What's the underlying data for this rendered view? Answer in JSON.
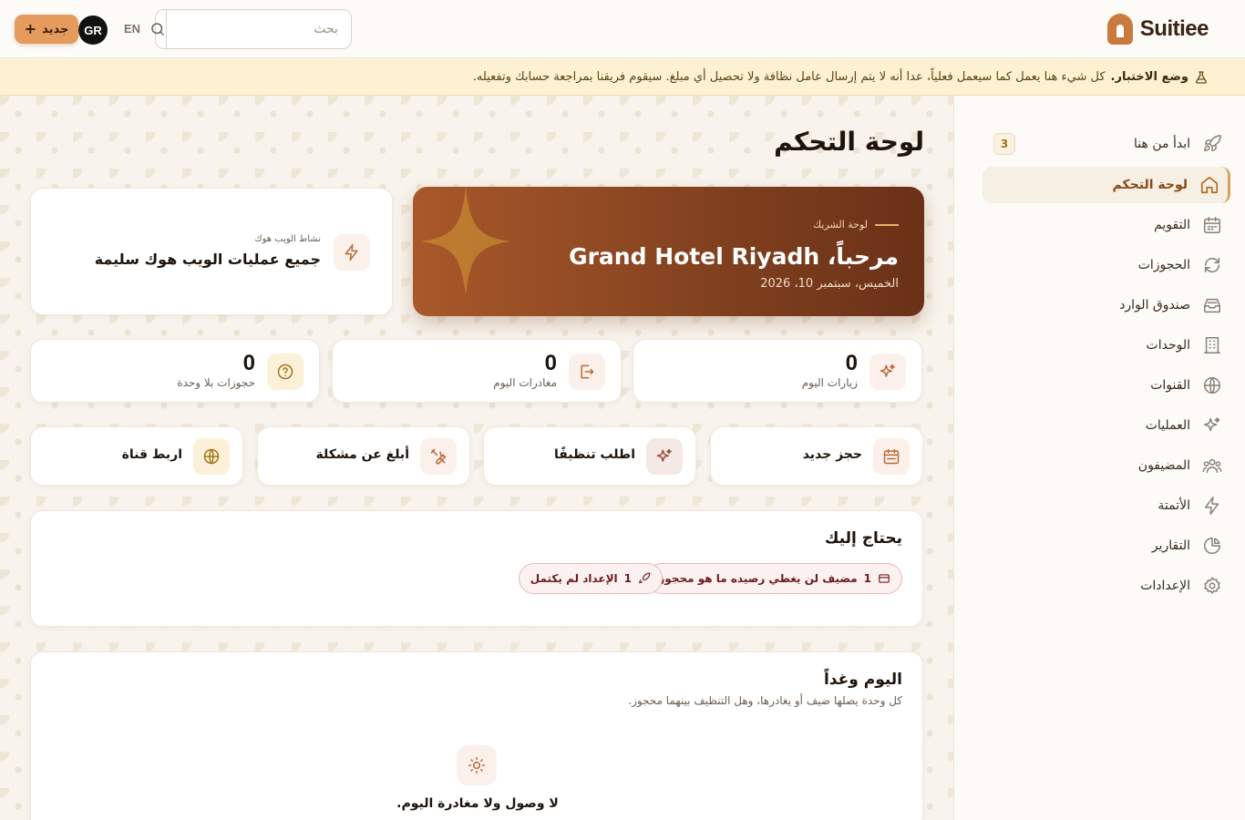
{
  "app": {
    "brand": "Suitiee"
  },
  "header": {
    "search_placeholder": "بحث",
    "lang": "EN",
    "avatar_initials": "GR",
    "new_label": "جديد"
  },
  "banner": {
    "title": "وضع الاختبار.",
    "text": "كل شيء هنا يعمل كما سيعمل فعلياً، عدا أنه لا يتم إرسال عامل نظافة ولا تحصيل أي مبلغ. سيقوم فريقنا بمراجعة حسابك وتفعيله."
  },
  "sidebar": {
    "items": [
      {
        "label": "ابدأ من هنا",
        "icon": "rocket-icon",
        "badge": "3"
      },
      {
        "label": "لوحة التحكم",
        "icon": "home-icon",
        "active": true
      },
      {
        "label": "التقويم",
        "icon": "calendar-icon"
      },
      {
        "label": "الحجوزات",
        "icon": "refresh-icon"
      },
      {
        "label": "صندوق الوارد",
        "icon": "inbox-icon"
      },
      {
        "label": "الوحدات",
        "icon": "building-icon"
      },
      {
        "label": "القنوات",
        "icon": "globe-icon"
      },
      {
        "label": "العمليات",
        "icon": "sparkles-icon"
      },
      {
        "label": "المضيفون",
        "icon": "users-icon"
      },
      {
        "label": "الأتمتة",
        "icon": "bolt-icon"
      },
      {
        "label": "التقارير",
        "icon": "pie-chart-icon"
      },
      {
        "label": "الإعدادات",
        "icon": "gear-icon"
      }
    ]
  },
  "main": {
    "title": "لوحة التحكم",
    "hero": {
      "kicker": "لوحة الشريك",
      "greeting": "مرحباً، Grand Hotel Riyadh",
      "date": "الخميس، سبتمبر 10، 2026"
    },
    "webhook": {
      "label": "نشاط الويب هوك",
      "status": "جميع عمليات الويب هوك سليمة"
    },
    "stats": [
      {
        "value": "0",
        "label": "زيارات اليوم",
        "icon": "sparkles-icon"
      },
      {
        "value": "0",
        "label": "مغادرات اليوم",
        "icon": "logout-icon"
      },
      {
        "value": "0",
        "label": "حجوزات بلا وحدة",
        "icon": "question-icon"
      }
    ],
    "actions": [
      {
        "label": "حجز جديد",
        "icon": "calendar-icon"
      },
      {
        "label": "اطلب تنظيفًا",
        "icon": "sparkles-icon"
      },
      {
        "label": "أبلغ عن مشكلة",
        "icon": "tools-icon"
      },
      {
        "label": "اربط قناة",
        "icon": "globe-icon"
      }
    ],
    "needs_you": {
      "title": "يحتاج إليك",
      "chips": [
        {
          "count": "1",
          "text": "مضيف لن يغطي رصيده ما هو محجوز",
          "icon": "wallet-icon"
        },
        {
          "count": "1",
          "text": "الإعداد لم يكتمل",
          "icon": "rocket-icon"
        }
      ]
    },
    "today": {
      "title": "اليوم وغداً",
      "subtitle": "كل وحدة يصلها ضيف أو يغادرها، وهل التنظيف بينهما محجوز.",
      "empty": "لا وصول ولا مغادرة اليوم."
    }
  },
  "colors": {
    "accent": "#c97a3c",
    "hero_start": "#a9582a",
    "hero_end": "#6a3118",
    "banner": "#fdf1d2"
  }
}
